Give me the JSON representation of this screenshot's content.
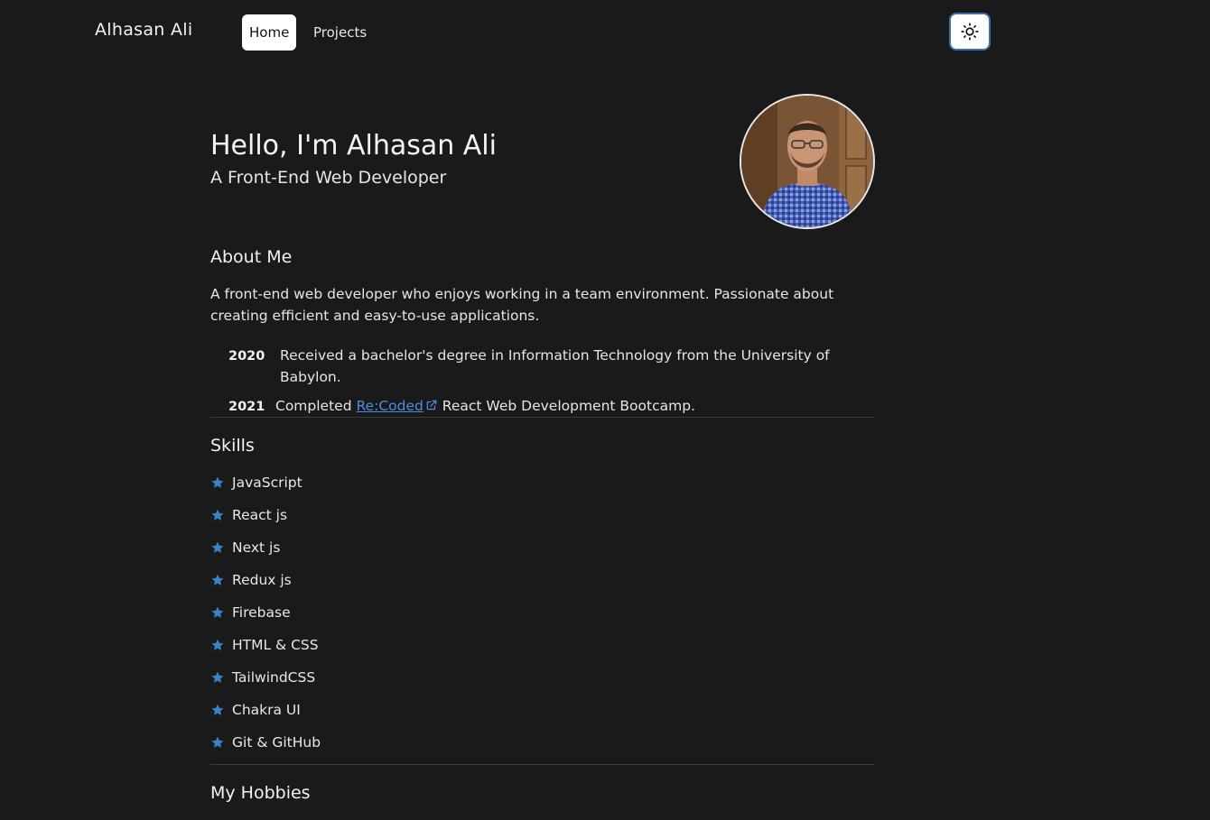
{
  "nav": {
    "brand": "Alhasan Ali",
    "links": [
      {
        "label": "Home",
        "active": true
      },
      {
        "label": "Projects",
        "active": false
      }
    ],
    "theme_toggle_icon": "sun-icon"
  },
  "hero": {
    "greeting": "Hello, I'm Alhasan Ali",
    "subtitle": "A Front-End Web Developer",
    "avatar_icon": "profile-photo"
  },
  "about": {
    "title": "About Me",
    "text": "A front-end web developer who enjoys working in a team environment. Passionate about creating efficient and easy-to-use applications.",
    "timeline": [
      {
        "year": "2020",
        "text": "Received a bachelor's degree in Information Technology from the University of Babylon."
      },
      {
        "year": "2021",
        "prefix": "Completed",
        "link": "Re:Coded",
        "suffix": "React Web Development Bootcamp."
      }
    ]
  },
  "skills": {
    "title": "Skills",
    "items": [
      "JavaScript",
      "React js",
      "Next js",
      "Redux js",
      "Firebase",
      "HTML & CSS",
      "TailwindCSS",
      "Chakra UI",
      "Git & GitHub"
    ]
  },
  "hobbies": {
    "title": "My Hobbies"
  },
  "colors": {
    "background": "#1a1a1a",
    "accent": "#4a8fe0",
    "star": "#3b82c8"
  }
}
